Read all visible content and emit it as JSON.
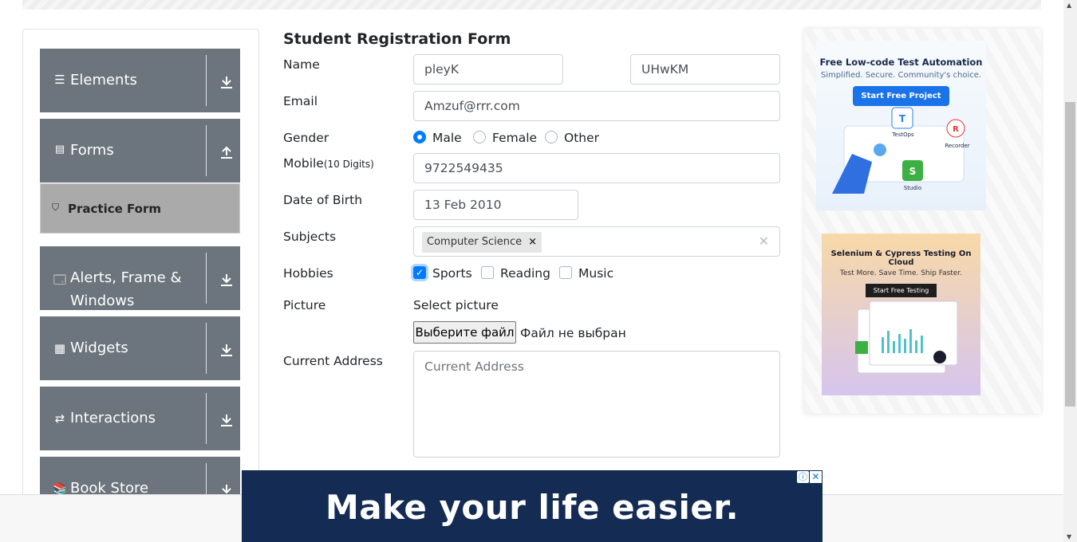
{
  "sidebar": {
    "groups": [
      {
        "label": "Elements",
        "icon": "list-icon",
        "arrow": "download-arrow-icon"
      },
      {
        "label": "Forms",
        "icon": "document-icon",
        "arrow": "upload-arrow-icon"
      },
      {
        "label": "Alerts, Frame &",
        "label2": "Windows",
        "icon": "window-icon",
        "arrow": "download-arrow-icon"
      },
      {
        "label": "Widgets",
        "icon": "widgets-icon",
        "arrow": "download-arrow-icon"
      },
      {
        "label": "Interactions",
        "icon": "interactions-icon",
        "arrow": "download-arrow-icon"
      },
      {
        "label": "Book Store",
        "icon": "book-store-icon",
        "arrow": "download-arrow-icon"
      }
    ],
    "active_item": "Practice Form"
  },
  "form": {
    "title": "Student Registration Form",
    "name_label": "Name",
    "first_name": "pleyK",
    "last_name": "UHwKM",
    "email_label": "Email",
    "email": "Amzuf@rrr.com",
    "gender_label": "Gender",
    "gender_options": [
      "Male",
      "Female",
      "Other"
    ],
    "gender_selected": "Male",
    "mobile_label": "Mobile",
    "mobile_hint": "(10 Digits)",
    "mobile": "9722549435",
    "dob_label": "Date of Birth",
    "dob": "13 Feb 2010",
    "subjects_label": "Subjects",
    "subjects": [
      "Computer Science"
    ],
    "hobbies_label": "Hobbies",
    "hobbies": [
      "Sports",
      "Reading",
      "Music"
    ],
    "hobbies_checked": [
      "Sports"
    ],
    "picture_label": "Picture",
    "select_picture": "Select picture",
    "file_button": "Выберите файл",
    "file_status": "Файл не выбран",
    "address_label": "Current Address",
    "address_placeholder": "Current Address"
  },
  "ads": {
    "ad1": {
      "headline": "Free Low-code Test Automation",
      "sub": "Simplified. Secure. Community's choice.",
      "button": "Start Free Project",
      "tiles": [
        "TestOps",
        "Recorder",
        "Studio"
      ]
    },
    "ad2": {
      "headline": "Selenium & Cypress Testing On Cloud",
      "sub": "Test More. Save Time. Ship Faster.",
      "button": "Start Free Testing"
    }
  },
  "banner": {
    "text": "Make your life easier.",
    "info": "ⓘ",
    "close": "✕"
  },
  "colors": {
    "sidebar_group": "#6c757d",
    "accent": "#007bff",
    "banner": "#142b54"
  }
}
